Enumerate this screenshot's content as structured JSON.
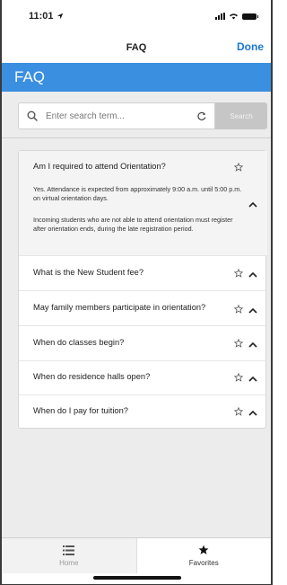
{
  "status_bar": {
    "time": "11:01",
    "location_icon": "location-arrow-icon",
    "signal_icon": "signal-icon",
    "wifi_icon": "wifi-icon",
    "battery_icon": "battery-icon"
  },
  "nav": {
    "title": "FAQ",
    "done_label": "Done"
  },
  "header": {
    "title": "FAQ",
    "color": "#3a8fe0"
  },
  "search": {
    "placeholder": "Enter search term...",
    "value": "",
    "button_label": "Search",
    "search_icon": "search-icon",
    "clear_icon": "refresh-icon"
  },
  "faq": {
    "items": [
      {
        "question": "Am I required to attend Orientation?",
        "expanded": true,
        "answer_p1": "Yes. Attendance is expected from approximately 9:00 a.m. until 5:00 p.m. on virtual orientation days.",
        "answer_p2": "Incoming students who are not able to attend orientation must register after orientation ends, during the late registration period."
      },
      {
        "question": "What is the New Student fee?",
        "expanded": false
      },
      {
        "question": "May family members participate in orientation?",
        "expanded": false
      },
      {
        "question": "When do classes begin?",
        "expanded": false
      },
      {
        "question": "When do residence halls open?",
        "expanded": false
      },
      {
        "question": "When do I pay for tuition?",
        "expanded": false
      }
    ]
  },
  "tabs": [
    {
      "label": "Home",
      "icon": "list-icon",
      "active": false
    },
    {
      "label": "Favorites",
      "icon": "star-icon",
      "active": true
    }
  ]
}
